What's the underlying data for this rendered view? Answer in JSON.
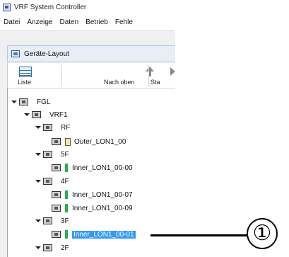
{
  "window": {
    "title": "VRF System Controller"
  },
  "menubar": {
    "items": [
      "Datei",
      "Anzeige",
      "Daten",
      "Betrieb",
      "Fehle"
    ]
  },
  "document_tab": {
    "label": "Geräte-Layout"
  },
  "toolbar": {
    "buttons": [
      {
        "label": "Liste",
        "icon": "list-icon"
      },
      {
        "label": "Nach oben",
        "icon": "arrow-up-icon"
      },
      {
        "label": "Sta",
        "icon": "start-icon"
      }
    ]
  },
  "tree": {
    "nodes": [
      {
        "label": "FGL",
        "expander": true,
        "icon": "device-group-icon"
      },
      {
        "label": "VRF1",
        "expander": true,
        "icon": "device-group-icon"
      },
      {
        "label": "RF",
        "expander": true,
        "icon": "device-group-icon"
      },
      {
        "label": "Outer_LON1_00",
        "expander": false,
        "icon": "outdoor-unit-icon"
      },
      {
        "label": "5F",
        "expander": true,
        "icon": "device-group-icon"
      },
      {
        "label": "Inner_LON1_00-00",
        "expander": false,
        "icon": "indoor-unit-icon",
        "status_color": "#22b14c"
      },
      {
        "label": "4F",
        "expander": true,
        "icon": "device-group-icon"
      },
      {
        "label": "Inner_LON1_00-07",
        "expander": false,
        "icon": "indoor-unit-icon",
        "status_color": "#22b14c"
      },
      {
        "label": "Inner_LON1_00-09",
        "expander": false,
        "icon": "indoor-unit-icon",
        "status_color": "#22b14c"
      },
      {
        "label": "3F",
        "expander": true,
        "icon": "device-group-icon"
      },
      {
        "label": "Inner_LON1_00-01",
        "expander": false,
        "icon": "indoor-unit-icon",
        "status_color": "#22b14c",
        "selected": true
      },
      {
        "label": "2F",
        "expander": true,
        "icon": "device-group-icon"
      }
    ]
  },
  "callout": {
    "label": "①"
  },
  "colors": {
    "selection": "#3399ff",
    "status_ok": "#22b14c"
  }
}
